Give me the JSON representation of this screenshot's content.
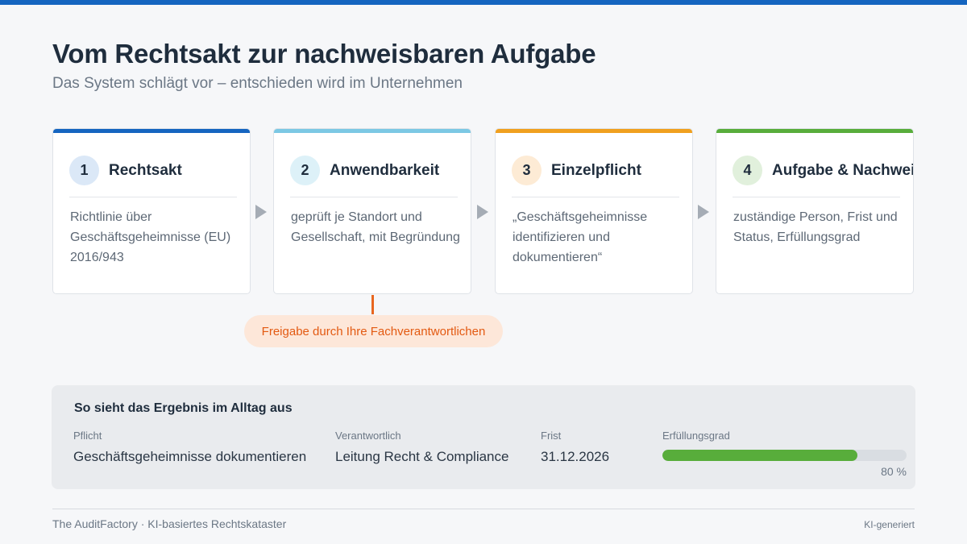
{
  "header": {
    "title": "Vom Rechtsakt zur nachweisbaren Aufgabe",
    "subtitle": "Das System schlägt vor – entschieden wird im Unternehmen"
  },
  "steps": [
    {
      "num": "1",
      "title": "Rechtsakt",
      "body": "Richtlinie über Geschäftsgeheimnisse (EU) 2016/943",
      "accent": "#1565c0",
      "badge_bg": "#dbe8f7"
    },
    {
      "num": "2",
      "title": "Anwendbarkeit",
      "body": "geprüft je Standort und Gesellschaft, mit Begründung",
      "accent": "#7cc8e4",
      "badge_bg": "#ddf1f8"
    },
    {
      "num": "3",
      "title": "Einzelpflicht",
      "body": "„Geschäftsgeheimnisse identifizieren und dokumentieren“",
      "accent": "#f0a01f",
      "badge_bg": "#fdebd5"
    },
    {
      "num": "4",
      "title": "Aufgabe & Nachweis",
      "body": "zuständige Person, Frist und Status, Erfüllungsgrad",
      "accent": "#58ad3b",
      "badge_bg": "#e1f0dc"
    }
  ],
  "approval": {
    "label": "Freigabe durch Ihre Fachverantwortlichen",
    "color": "#e35a12"
  },
  "result": {
    "title": "So sieht das Ergebnis im Alltag aus",
    "columns": [
      {
        "label": "Pflicht",
        "value": "Geschäftsgeheimnisse dokumentieren"
      },
      {
        "label": "Verantwortlich",
        "value": "Leitung Recht & Compliance"
      },
      {
        "label": "Frist",
        "value": "31.12.2026"
      },
      {
        "label": "Erfüllungsgrad",
        "value": ""
      }
    ],
    "progress_percent": 80,
    "progress_text": "80 %",
    "progress_color": "#58ad3b"
  },
  "footer": {
    "left": "The AuditFactory · KI-basiertes Rechtskataster",
    "right": "KI-generiert"
  }
}
